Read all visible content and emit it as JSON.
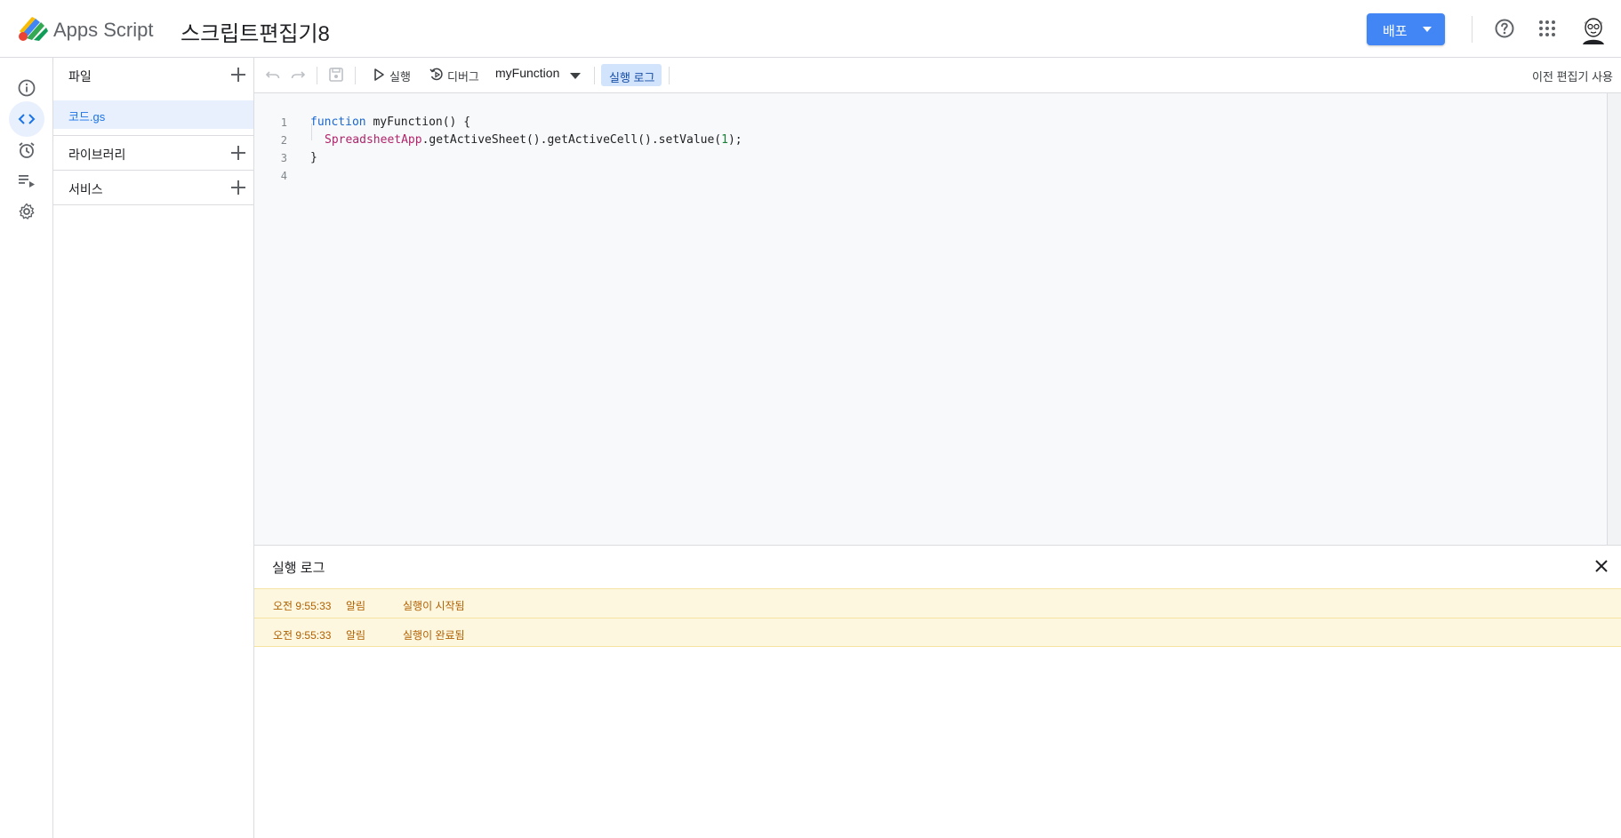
{
  "header": {
    "app_name": "Apps Script",
    "project_title": "스크립트편집기8",
    "deploy_label": "배포"
  },
  "rail": {
    "items": [
      "overview",
      "editor",
      "triggers",
      "executions",
      "settings"
    ]
  },
  "files_panel": {
    "files_label": "파일",
    "files": [
      "코드.gs"
    ],
    "libraries_label": "라이브러리",
    "services_label": "서비스"
  },
  "toolbar": {
    "run_label": "실행",
    "debug_label": "디버그",
    "function_name": "myFunction",
    "execution_log_label": "실행 로그",
    "old_editor_label": "이전 편집기 사용"
  },
  "code": {
    "line_numbers": [
      "1",
      "2",
      "3",
      "4"
    ],
    "l1_keyword": "function",
    "l1_rest": " myFunction() {",
    "l2_class": "SpreadsheetApp",
    "l2_mid": ".getActiveSheet().getActiveCell().setValue(",
    "l2_num": "1",
    "l2_end": ");",
    "l3": "}"
  },
  "log_panel": {
    "title": "실행 로그",
    "rows": [
      {
        "time": "오전 9:55:33",
        "level": "알림",
        "message": "실행이 시작됨"
      },
      {
        "time": "오전 9:55:33",
        "level": "알림",
        "message": "실행이 완료됨"
      }
    ]
  },
  "colors": {
    "accent": "#4285f4",
    "selected_bg": "#e8f0fe",
    "log_notice_bg": "#fef7e0",
    "log_notice_text": "#b06000"
  }
}
